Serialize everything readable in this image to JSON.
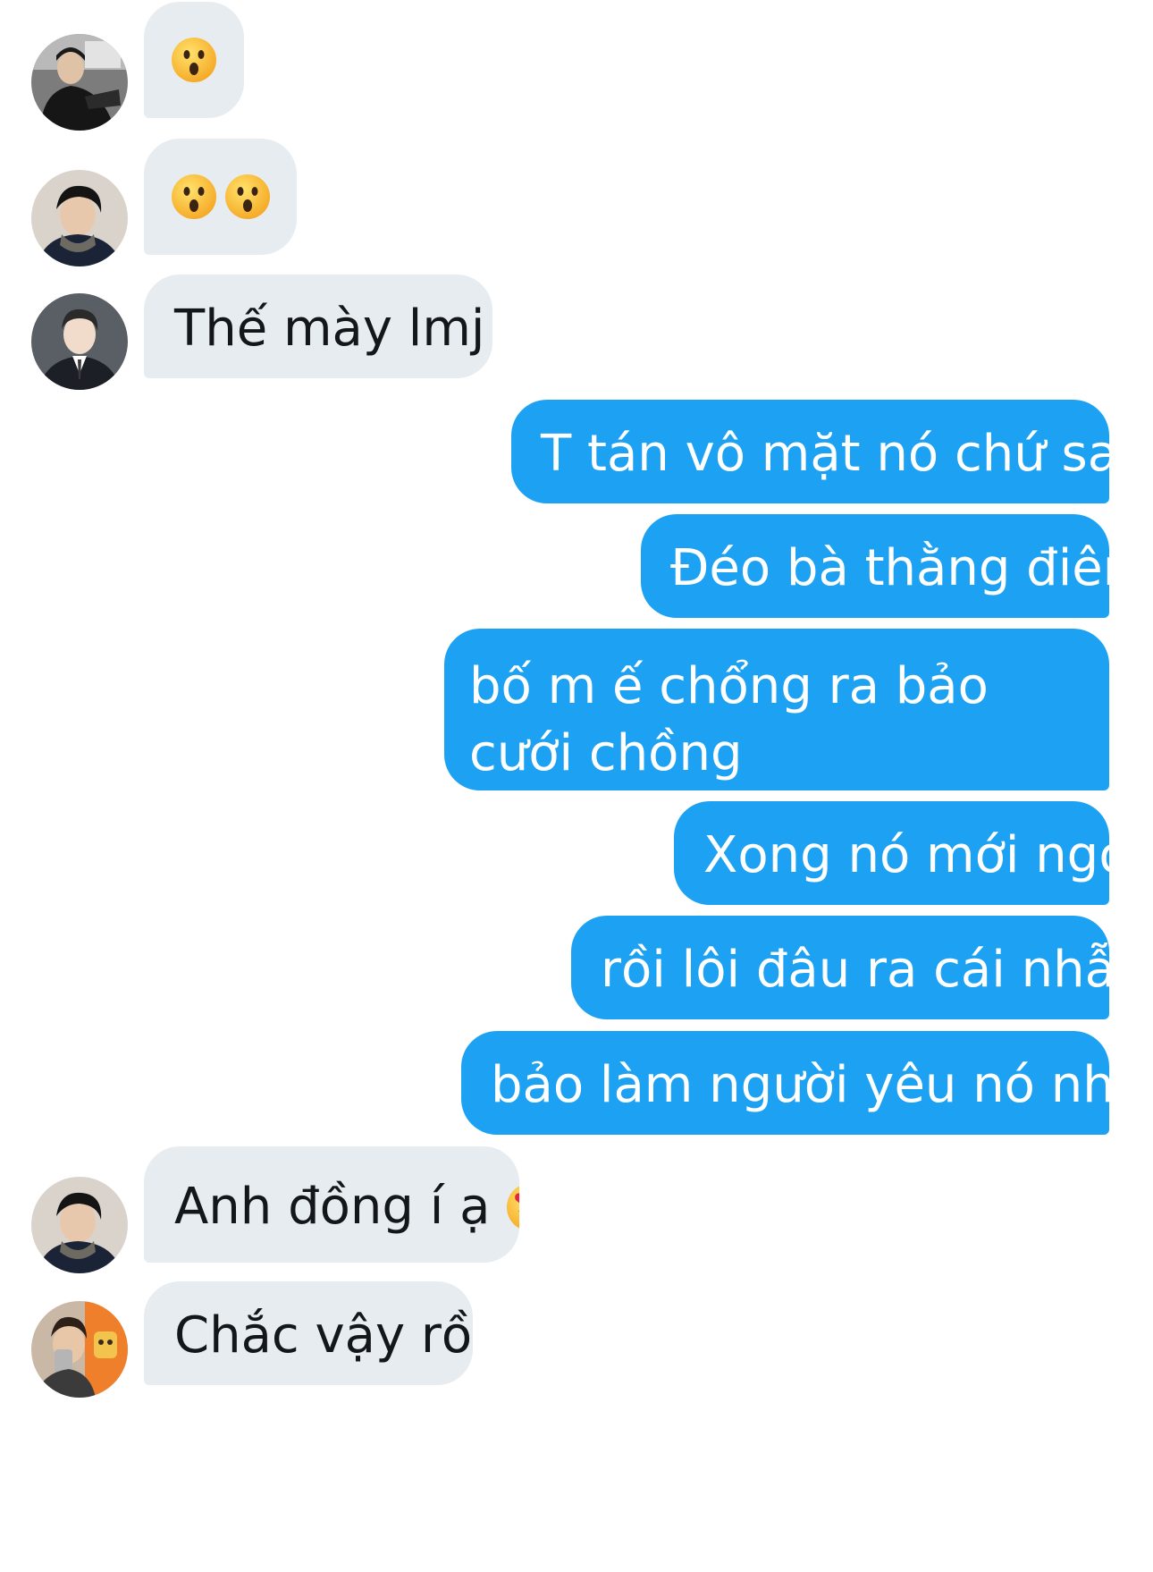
{
  "conversation": {
    "messages": [
      {
        "id": "m1",
        "direction": "incoming",
        "avatar": "avatar-man-dark-jacket",
        "text": "",
        "emoji": [
          "hushed-face-emoji"
        ]
      },
      {
        "id": "m2",
        "direction": "incoming",
        "avatar": "avatar-man-scarf",
        "text": "",
        "emoji": [
          "hushed-face-emoji",
          "hushed-face-emoji"
        ]
      },
      {
        "id": "m3",
        "direction": "incoming",
        "avatar": "avatar-man-suit",
        "text": "Thế mày lmj ?"
      },
      {
        "id": "m4",
        "direction": "outgoing",
        "text": "T tán vô mặt nó chứ sao"
      },
      {
        "id": "m5",
        "direction": "outgoing",
        "text": "Đéo bà thằng điên"
      },
      {
        "id": "m6",
        "direction": "outgoing",
        "text": "bố m ế chổng ra bảo cưới chồng"
      },
      {
        "id": "m7",
        "direction": "outgoing",
        "text": "Xong nó mới ngớ"
      },
      {
        "id": "m8",
        "direction": "outgoing",
        "text": "rồi lôi đâu ra cái nhẫn"
      },
      {
        "id": "m9",
        "direction": "outgoing",
        "text": "bảo làm người yêu nó nhé"
      },
      {
        "id": "m10",
        "direction": "incoming",
        "avatar": "avatar-man-scarf",
        "text": "Anh đồng í ạ",
        "emoji": [
          "heart-eyes-emoji"
        ]
      },
      {
        "id": "m11",
        "direction": "incoming",
        "avatar": "avatar-man-phone-selfie",
        "text": "Chắc vậy rồi"
      }
    ]
  },
  "colors": {
    "incoming_bubble": "#e6ecf0",
    "outgoing_bubble": "#1da1f2",
    "incoming_text": "#14171a",
    "outgoing_text": "#ffffff",
    "background": "#ffffff"
  }
}
